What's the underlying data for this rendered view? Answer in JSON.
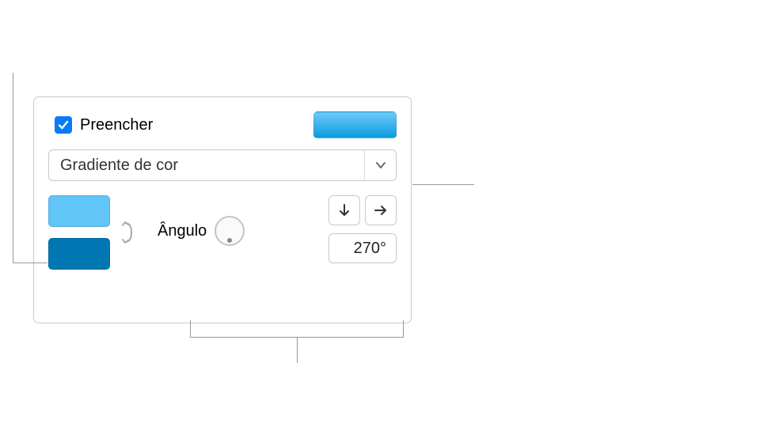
{
  "fill": {
    "checkbox_checked": true,
    "label": "Preencher",
    "type_selected": "Gradiente de cor",
    "preview_gradient": [
      "#6fcbf7",
      "#0a9be0"
    ],
    "color_stops": [
      {
        "hex": "#61c5f7"
      },
      {
        "hex": "#0077b3"
      }
    ],
    "angle": {
      "label": "Ângulo",
      "value": "270°"
    }
  }
}
